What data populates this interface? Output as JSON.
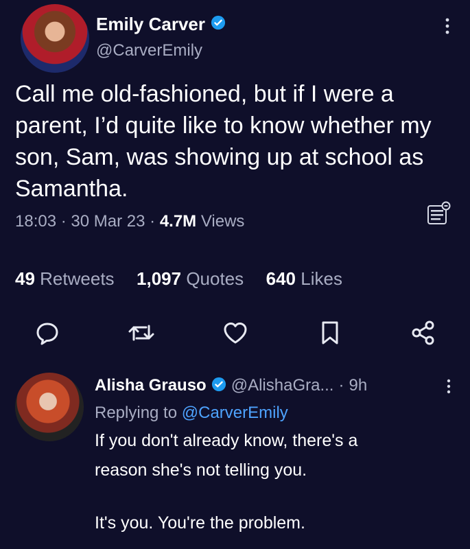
{
  "tweet": {
    "author_name": "Emily Carver",
    "author_handle": "@CarverEmily",
    "text": "Call me old-fashioned, but if I were a parent, I’d quite like to know whether my son, Sam, was showing up at school as Samantha.",
    "time": "18:03",
    "date": "30 Mar 23",
    "views_count": "4.7M",
    "views_label": "Views",
    "retweets_count": "49",
    "retweets_label": "Retweets",
    "quotes_count": "1,097",
    "quotes_label": "Quotes",
    "likes_count": "640",
    "likes_label": "Likes",
    "separator": "·"
  },
  "reply": {
    "author_name": "Alisha Grauso",
    "author_handle": "@AlishaGra...",
    "age": "9h",
    "separator": "·",
    "replying_prefix": "Replying to",
    "replying_handle": "@CarverEmily",
    "text_line1": "If you don't already know, there's a",
    "text_line2": "reason she's not telling you.",
    "text_line3": "It's you. You're the problem."
  },
  "icons": {
    "more": "more-vertical-icon",
    "verified": "verified-badge-icon",
    "analytics": "analytics-icon",
    "reply": "reply-icon",
    "retweet": "retweet-icon",
    "like": "like-icon",
    "bookmark": "bookmark-icon",
    "share": "share-icon"
  },
  "colors": {
    "background": "#0f0f2a",
    "text": "#f2f2f7",
    "muted": "#a9adc3",
    "link": "#4ea3ff",
    "verified": "#1d9bf0"
  }
}
